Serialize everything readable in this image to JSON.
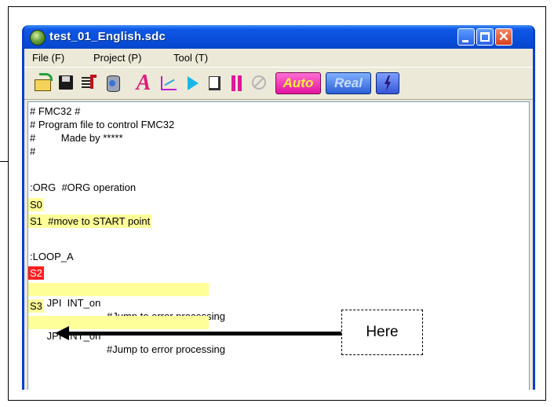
{
  "window": {
    "title": "test_01_English.sdc"
  },
  "menu": {
    "items": [
      "File (F)",
      "Project (P)",
      "Tool (T)"
    ]
  },
  "toolbar": {
    "buttons": [
      {
        "name": "open-icon"
      },
      {
        "name": "save-icon"
      },
      {
        "name": "export-icon"
      },
      {
        "name": "database-icon"
      },
      {
        "name": "text-icon",
        "glyph": "A"
      },
      {
        "name": "graph-icon"
      },
      {
        "name": "play-icon"
      },
      {
        "name": "step-icon"
      },
      {
        "name": "pause-icon"
      },
      {
        "name": "stop-icon"
      },
      {
        "name": "auto-button",
        "label": "Auto"
      },
      {
        "name": "real-button",
        "label": "Real"
      },
      {
        "name": "flash-icon"
      }
    ]
  },
  "editor": {
    "lines": [
      {
        "text": "# FMC32 #",
        "highlight": "none"
      },
      {
        "text": "# Program file to control FMC32",
        "highlight": "none"
      },
      {
        "text": "#         Made by *****",
        "highlight": "none"
      },
      {
        "text": "#",
        "highlight": "none"
      },
      {
        "text": "",
        "highlight": "none"
      },
      {
        "text": ":ORG  #ORG operation",
        "highlight": "none"
      },
      {
        "text": "S0",
        "highlight": "yellow"
      },
      {
        "text": "S1  #move to START point",
        "highlight": "yellow"
      },
      {
        "text": "",
        "highlight": "none"
      },
      {
        "text": ":LOOP_A",
        "highlight": "none"
      },
      {
        "text": "S2",
        "highlight": "red"
      },
      {
        "code": "JPI  INT_on",
        "comment": "#Jump to error processing",
        "highlight": "yellow"
      },
      {
        "text": "S3",
        "highlight": "yellow"
      },
      {
        "code": "JPI  INT_on",
        "comment": "#Jump to error processing",
        "highlight": "yellow"
      }
    ]
  },
  "callout": {
    "label": "Here"
  },
  "colors": {
    "title_bar": "#0a4fdc",
    "highlight_yellow": "#ffff99",
    "highlight_red": "#ff1e1e"
  }
}
